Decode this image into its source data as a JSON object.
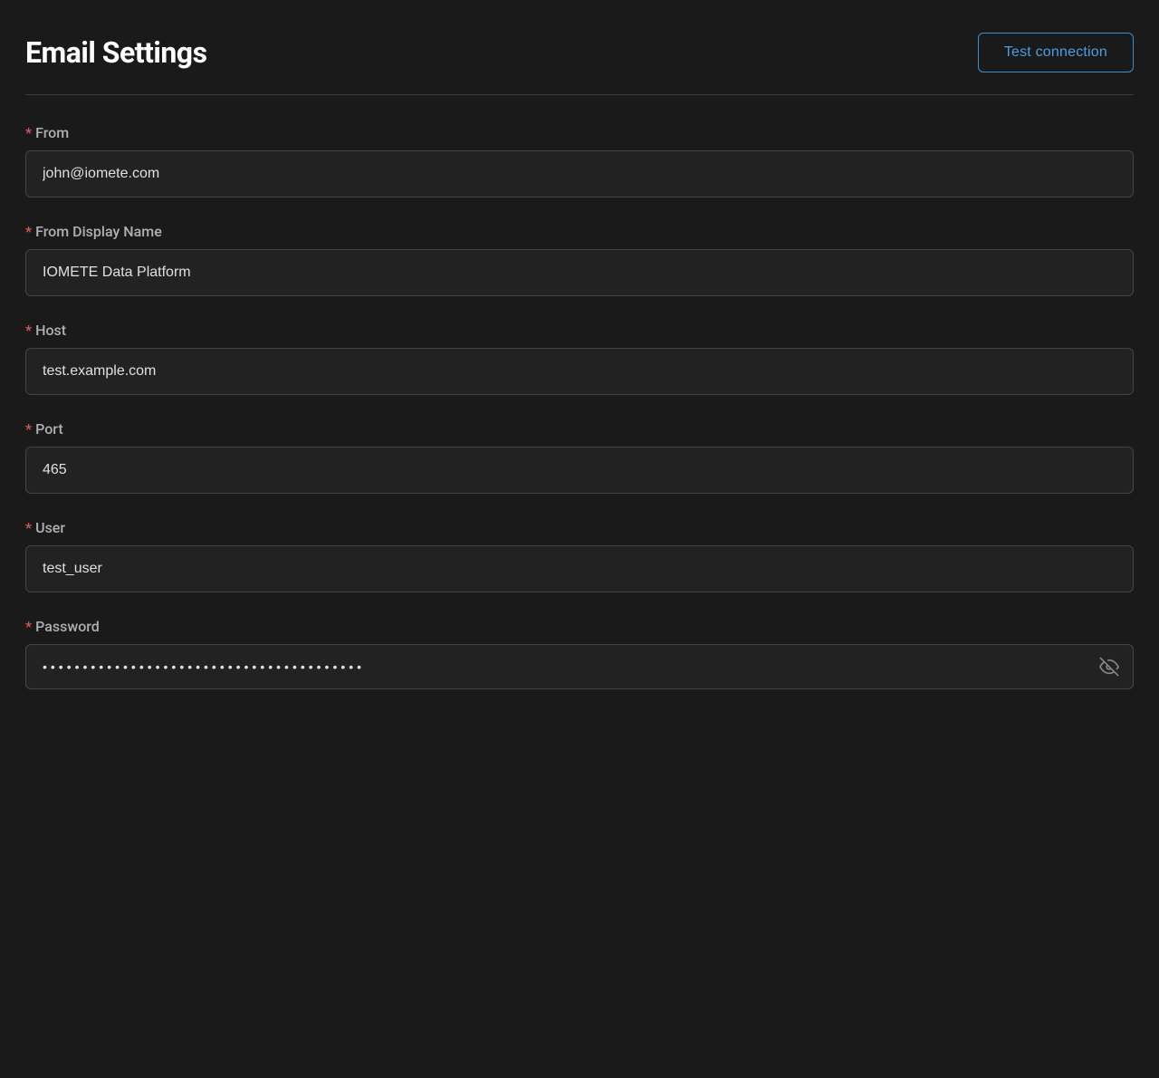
{
  "page": {
    "title": "Email Settings",
    "test_connection_label": "Test connection"
  },
  "form": {
    "from": {
      "label": "From",
      "value": "john@iomete.com",
      "placeholder": ""
    },
    "from_display_name": {
      "label": "From Display Name",
      "value": "IOMETE Data Platform",
      "placeholder": ""
    },
    "host": {
      "label": "Host",
      "value": "test.example.com",
      "placeholder": ""
    },
    "port": {
      "label": "Port",
      "value": "465",
      "placeholder": ""
    },
    "user": {
      "label": "User",
      "value": "test_user",
      "placeholder": ""
    },
    "password": {
      "label": "Password",
      "value": "••••••••••••••••••••••••••••••••••••••••",
      "placeholder": ""
    }
  },
  "icons": {
    "eye_off": "eye-off-icon"
  }
}
